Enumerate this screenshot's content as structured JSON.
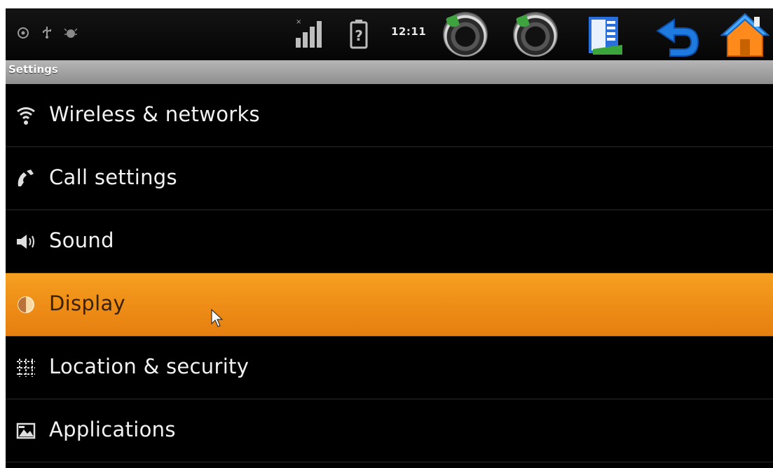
{
  "status_bar": {
    "clock": "12:11",
    "icons": [
      "alarm-icon",
      "usb-icon",
      "debug-icon",
      "signal-icon",
      "battery-unknown-icon"
    ]
  },
  "nav_buttons": [
    "volume-down-icon",
    "volume-up-icon",
    "menu-icon",
    "back-icon",
    "home-icon"
  ],
  "title_bar": {
    "title": "Settings"
  },
  "settings": {
    "items": [
      {
        "label": "Wireless & networks",
        "icon": "wifi-icon"
      },
      {
        "label": "Call settings",
        "icon": "phone-icon"
      },
      {
        "label": "Sound",
        "icon": "speaker-icon"
      },
      {
        "label": "Display",
        "icon": "display-icon",
        "selected": true
      },
      {
        "label": "Location & security",
        "icon": "location-grid-icon"
      },
      {
        "label": "Applications",
        "icon": "applications-icon"
      }
    ]
  },
  "colors": {
    "selected_row": "#ee8e17",
    "background": "#000000",
    "title_bar": "#a0a0a0"
  }
}
